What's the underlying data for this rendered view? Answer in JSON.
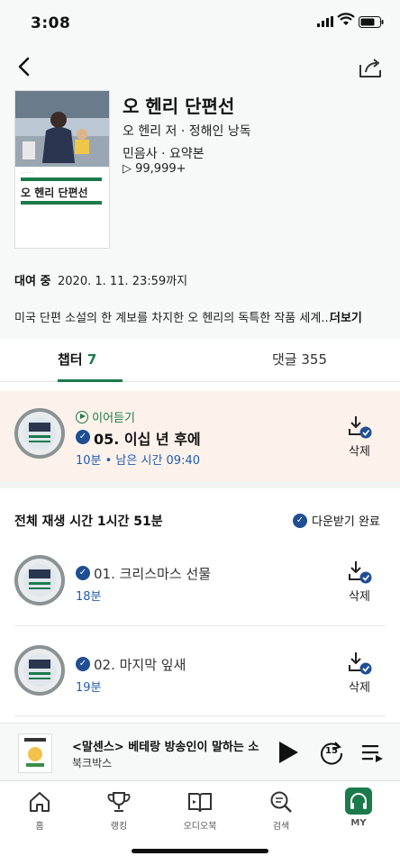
{
  "status": {
    "time": "3:08"
  },
  "book": {
    "title": "오 헨리 단편선",
    "author": "오 헨리 저 · 정해인 낭독",
    "publisher": "민음사 · 요약본",
    "plays": "▷ 99,999+",
    "cover_title": "오 헨리 단편선"
  },
  "rental": {
    "label": "대여 중",
    "date": "2020. 1. 11. 23:59까지"
  },
  "description": {
    "text": "미국 단편 소설의 한 계보를 차지한 오 헨리의 독특한 작품 세계...",
    "more": "더보기"
  },
  "tabs": [
    {
      "label": "챕터",
      "count": "7"
    },
    {
      "label": "댓글 355"
    }
  ],
  "continue": {
    "label": "이어듣기",
    "chapter_title": "05. 이십 년 후에",
    "meta": "10분 • 남은 시간 09:40",
    "delete_label": "삭제"
  },
  "total": {
    "label": "전체 재생 시간 1시간 51분",
    "download_status": "다운받기 완료"
  },
  "chapters": [
    {
      "title": "01. 크리스마스 선물",
      "duration": "18분",
      "delete_label": "삭제"
    },
    {
      "title": "02. 마지막 잎새",
      "duration": "19분",
      "delete_label": "삭제"
    }
  ],
  "player": {
    "title": "<말센스> 베테랑 방송인이 말하는 소",
    "subtitle": "북크박스",
    "skip_label": "15"
  },
  "tabbar": [
    {
      "label": "홈"
    },
    {
      "label": "랭킹"
    },
    {
      "label": "오디오북"
    },
    {
      "label": "검색"
    },
    {
      "label": "MY"
    }
  ],
  "colors": {
    "accent": "#1b7a4b",
    "check_blue": "#1f4e93",
    "highlight_bg": "#fdf2eb"
  }
}
